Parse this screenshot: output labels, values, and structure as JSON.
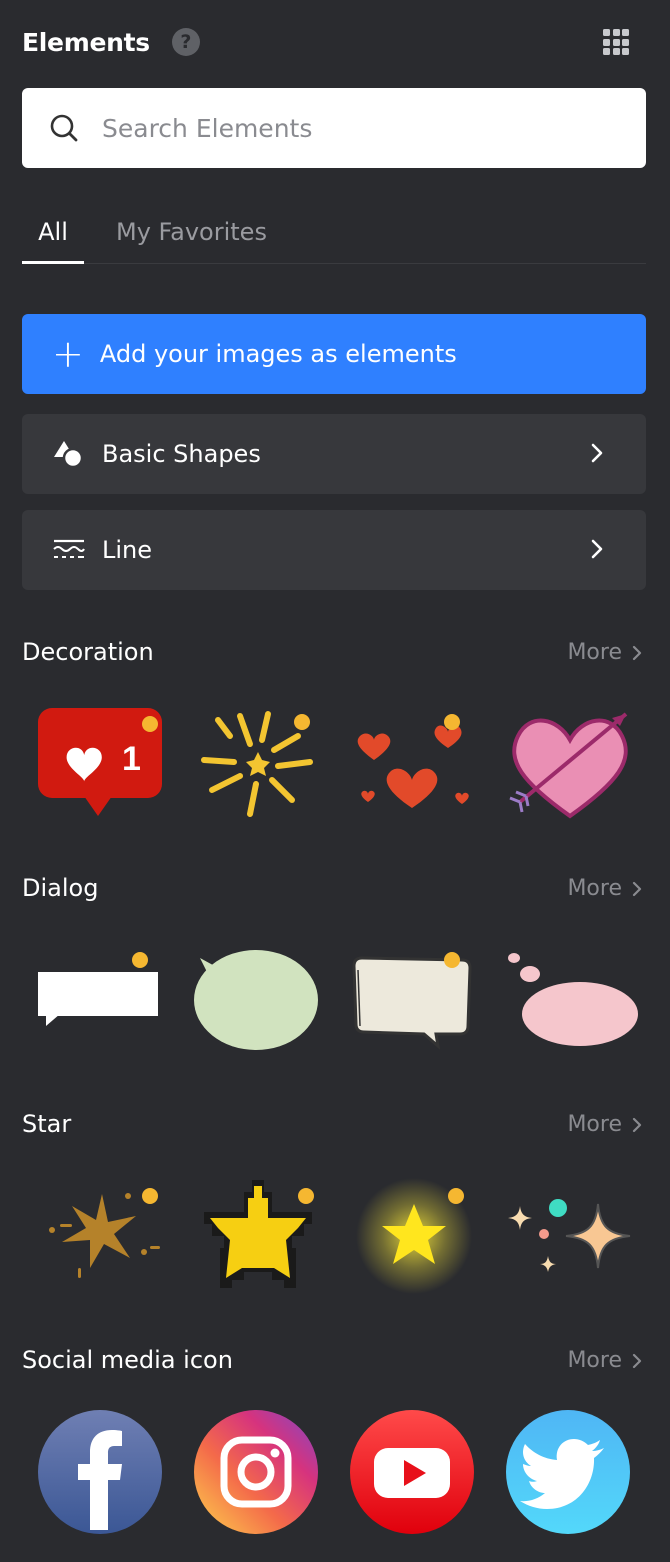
{
  "header": {
    "title": "Elements",
    "help_glyph": "?",
    "grid_icon": "apps-grid-icon"
  },
  "search": {
    "placeholder": "Search Elements",
    "value": ""
  },
  "tabs": [
    {
      "label": "All",
      "active": true
    },
    {
      "label": "My Favorites",
      "active": false
    }
  ],
  "add_button": {
    "label": "Add your images as elements",
    "color": "#2f80ff"
  },
  "rows": [
    {
      "label": "Basic Shapes",
      "icon": "shapes-icon"
    },
    {
      "label": "Line",
      "icon": "line-style-icon"
    }
  ],
  "sections": [
    {
      "title": "Decoration",
      "more": "More",
      "items": [
        "like-notification-icon",
        "sparkle-burst-icon",
        "hearts-icon",
        "heart-arrow-icon"
      ]
    },
    {
      "title": "Dialog",
      "more": "More",
      "items": [
        "rectangle-speech-bubble-icon",
        "oval-speech-bubble-icon",
        "sketch-speech-bubble-icon",
        "thought-bubble-icon"
      ]
    },
    {
      "title": "Star",
      "more": "More",
      "items": [
        "ink-splash-star-icon",
        "pixel-star-icon",
        "glowing-star-icon",
        "twinkle-stars-icon"
      ]
    },
    {
      "title": "Social media icon",
      "more": "More",
      "items": [
        "facebook-icon",
        "instagram-icon",
        "youtube-icon",
        "twitter-icon"
      ]
    }
  ],
  "decoration": {
    "like_count": "1"
  },
  "colors": {
    "background": "#2a2b2f",
    "row_bg": "#37383c",
    "accent": "#2f80ff",
    "badge_dot": "#f5b731",
    "muted_text": "#9a9ba0"
  }
}
